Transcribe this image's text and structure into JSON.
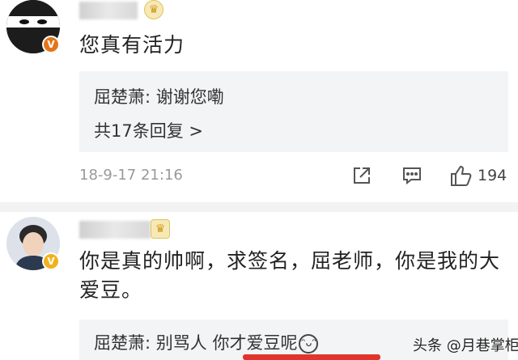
{
  "comments": [
    {
      "text": "您真有活力",
      "verified_badge": "V",
      "reply": {
        "author": "屈楚萧",
        "text": "谢谢您嘞"
      },
      "reply_more": "共17条回复 >",
      "time": "18-9-17 21:16",
      "likes": "194"
    },
    {
      "text": "你是真的帅啊，求签名，屈老师，你是我的大爱豆。",
      "verified_badge": "V",
      "reply": {
        "author": "屈楚萧",
        "text": "别骂人 你才爱豆呢"
      }
    }
  ],
  "watermark": "头条 @月巷掌柜",
  "icons": [
    "avatar",
    "verified-badge",
    "crown-icon",
    "share-icon",
    "comment-icon",
    "like-icon",
    "laugh-emoji-icon"
  ],
  "colors": {
    "reply_bg": "#f3f4f6",
    "meta_gray": "#999999",
    "badge_orange": "#e2761b",
    "bar_red": "#e0352b"
  }
}
